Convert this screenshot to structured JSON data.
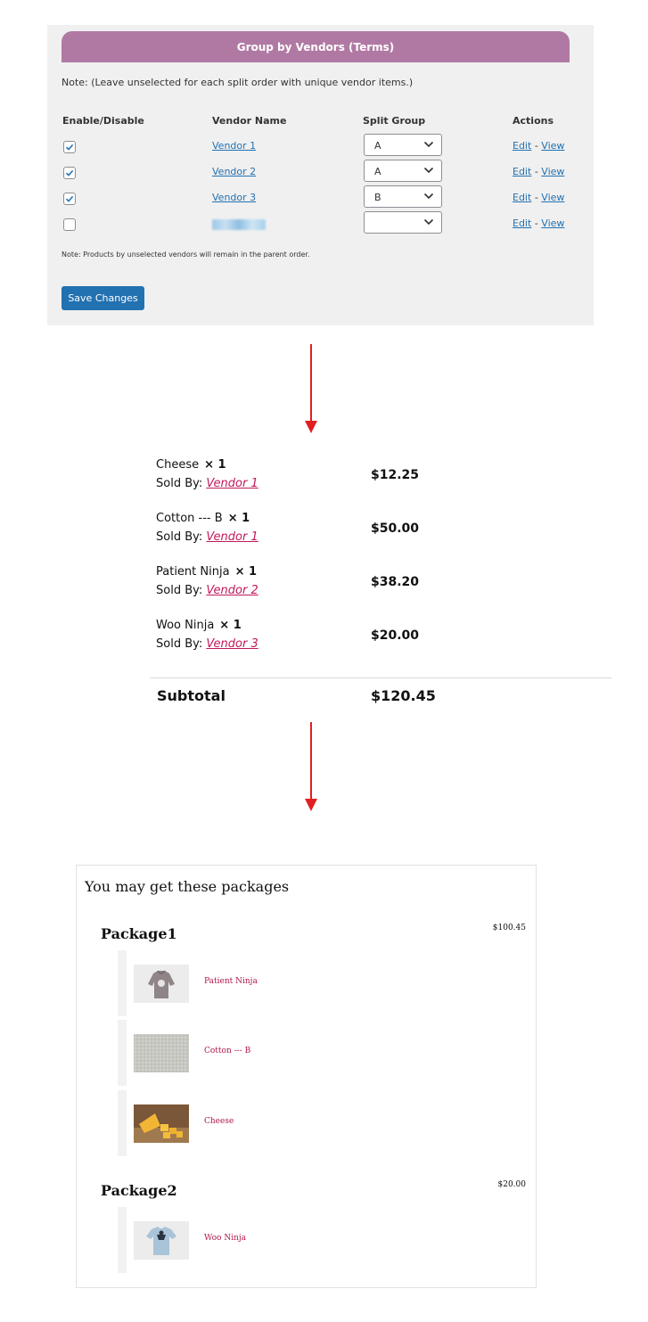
{
  "settings": {
    "header_title": "Group by Vendors (Terms)",
    "note_top": "Note: (Leave unselected for each split order with unique vendor items.)",
    "columns": [
      "Enable/Disable",
      "Vendor Name",
      "Split Group",
      "Actions"
    ],
    "rows": [
      {
        "enabled": true,
        "vendor": "Vendor 1",
        "group": "A",
        "edit": "Edit",
        "sep": "-",
        "view": "View"
      },
      {
        "enabled": true,
        "vendor": "Vendor 2",
        "group": "A",
        "edit": "Edit",
        "sep": "-",
        "view": "View"
      },
      {
        "enabled": true,
        "vendor": "Vendor 3",
        "group": "B",
        "edit": "Edit",
        "sep": "-",
        "view": "View"
      },
      {
        "enabled": false,
        "vendor": "",
        "group": "",
        "edit": "Edit",
        "sep": "-",
        "view": "View"
      }
    ],
    "note_bottom": "Note: Products by unselected vendors will remain in the parent order.",
    "save_label": "Save Changes",
    "colors": {
      "header": "#b079a3",
      "link": "#2271b1",
      "button": "#2271b1"
    }
  },
  "cart": {
    "sold_by_label": "Sold By:",
    "items": [
      {
        "name": "Cheese",
        "qty": "× 1",
        "vendor": "Vendor 1",
        "price": "$12.25"
      },
      {
        "name": "Cotton --- B",
        "qty": "× 1",
        "vendor": "Vendor 1",
        "price": "$50.00"
      },
      {
        "name": "Patient Ninja",
        "qty": "× 1",
        "vendor": "Vendor 2",
        "price": "$38.20"
      },
      {
        "name": "Woo Ninja",
        "qty": "× 1",
        "vendor": "Vendor 3",
        "price": "$20.00"
      }
    ],
    "subtotal_label": "Subtotal",
    "subtotal_value": "$120.45",
    "colors": {
      "vendor_link": "#c2185b",
      "arrow": "#e02020"
    }
  },
  "packages": {
    "title": "You may get these packages",
    "list": [
      {
        "name": "Package1",
        "price": "$100.45",
        "items": [
          {
            "name": "Patient Ninja",
            "icon": "hoodie-image"
          },
          {
            "name": "Cotton --- B",
            "icon": "fabric-image"
          },
          {
            "name": "Cheese",
            "icon": "cheese-image"
          }
        ]
      },
      {
        "name": "Package2",
        "price": "$20.00",
        "items": [
          {
            "name": "Woo Ninja",
            "icon": "tshirt-image"
          }
        ]
      }
    ],
    "colors": {
      "item_link": "#b0194a"
    }
  }
}
